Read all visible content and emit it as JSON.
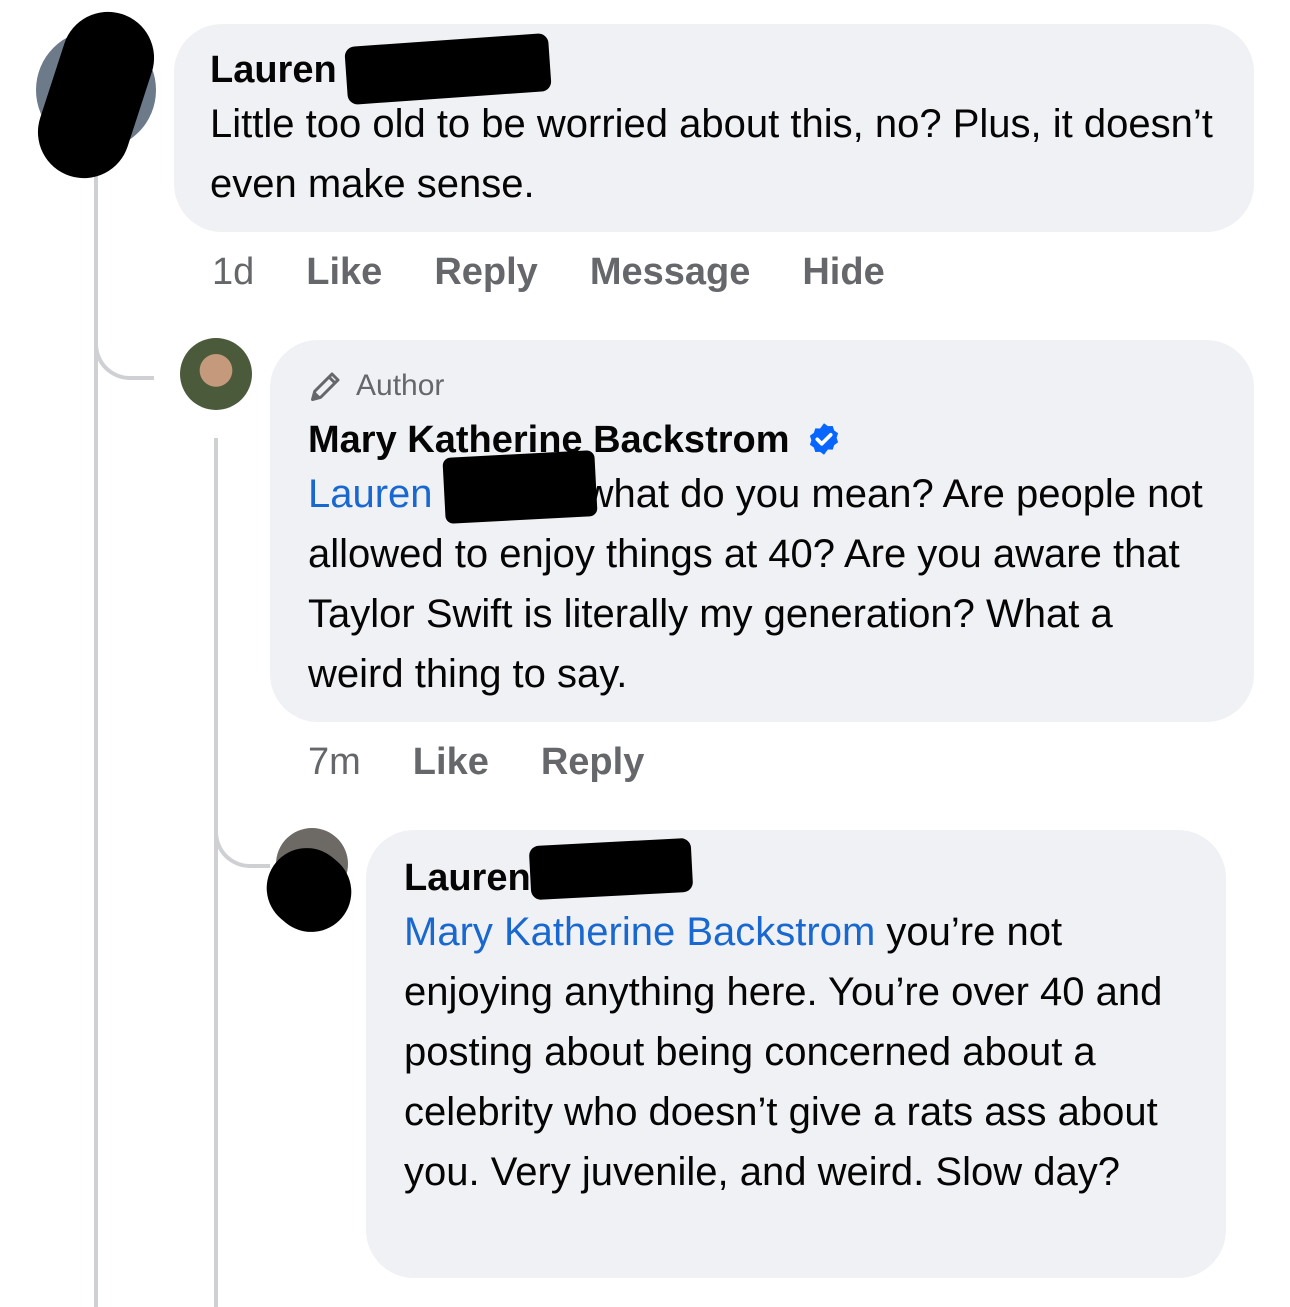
{
  "comments": [
    {
      "author": "Lauren",
      "text": "Little too old to be worried about this, no? Plus, it doesn’t even make sense.",
      "time": "1d",
      "actions": [
        "Like",
        "Reply",
        "Message",
        "Hide"
      ]
    },
    {
      "badge": "Author",
      "author": "Mary Katherine Backstrom",
      "verified": true,
      "mention": "Lauren",
      "text": "what do you mean? Are people not allowed to enjoy things at 40? Are you aware that Taylor Swift is literally my generation? What a weird thing to say.",
      "time": "7m",
      "actions": [
        "Like",
        "Reply"
      ]
    },
    {
      "author": "Lauren",
      "mention": "Mary Katherine Backstrom",
      "text": "you’re not enjoying anything here. You’re over 40 and posting about being concerned about a celebrity who doesn’t give a rats ass about you. Very juvenile, and weird. Slow day?"
    }
  ],
  "colors": {
    "bubble": "#f0f1f4",
    "mention": "#1868cf",
    "meta": "#65676b",
    "verified": "#0866ff"
  }
}
